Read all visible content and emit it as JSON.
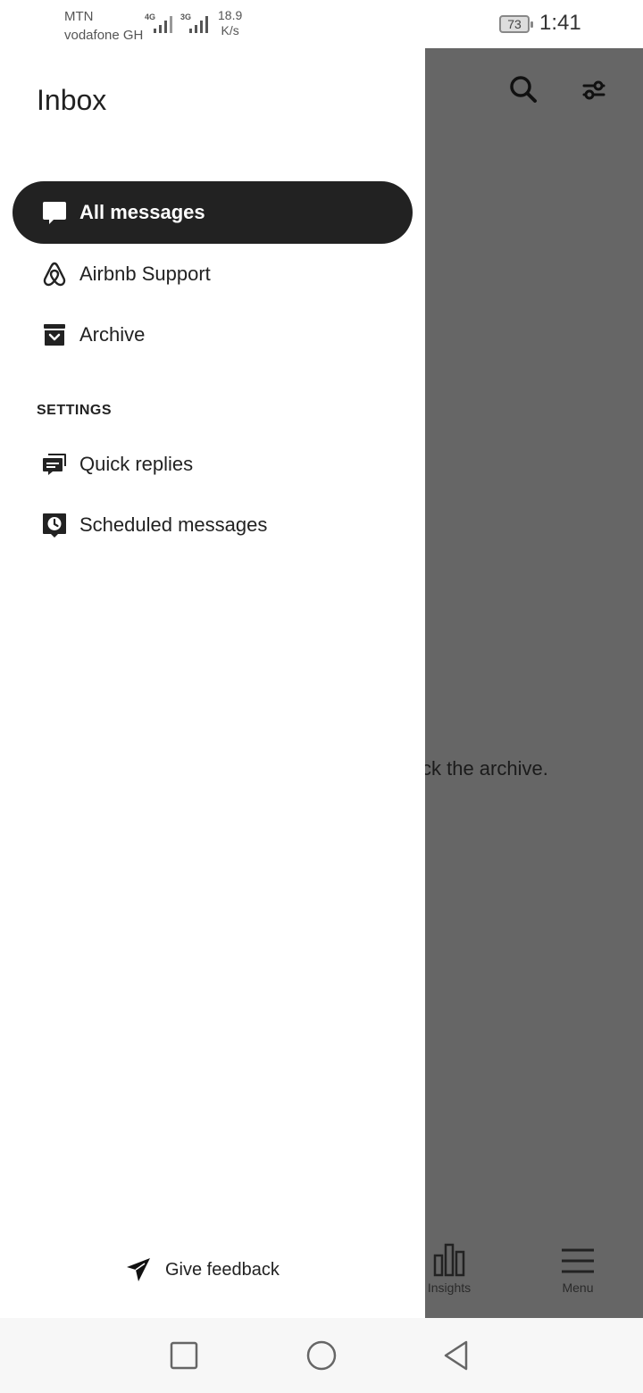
{
  "status_bar": {
    "carrier_1": "MTN",
    "carrier_2": "vodafone GH",
    "signal_1": "4G",
    "signal_2": "3G",
    "speed_value": "18.9",
    "speed_unit": "K/s",
    "battery": "73",
    "time": "1:41"
  },
  "drawer": {
    "title": "Inbox",
    "items": [
      {
        "label": "All messages",
        "icon": "message-icon",
        "active": true
      },
      {
        "label": "Airbnb Support",
        "icon": "airbnb-logo-icon"
      },
      {
        "label": "Archive",
        "icon": "archive-box-icon"
      }
    ],
    "settings_heading": "SETTINGS",
    "settings_items": [
      {
        "label": "Quick replies",
        "icon": "quick-replies-icon"
      },
      {
        "label": "Scheduled messages",
        "icon": "scheduled-message-icon"
      }
    ],
    "feedback_label": "Give feedback"
  },
  "background": {
    "partial_text": "ck the archive.",
    "tabs": [
      {
        "label": "Insights",
        "icon": "bar-chart-icon"
      },
      {
        "label": "Menu",
        "icon": "hamburger-menu-icon"
      }
    ]
  },
  "colors": {
    "active_item_bg": "#222222",
    "scrim": "#666666",
    "navbar_bg": "#f7f7f7"
  }
}
